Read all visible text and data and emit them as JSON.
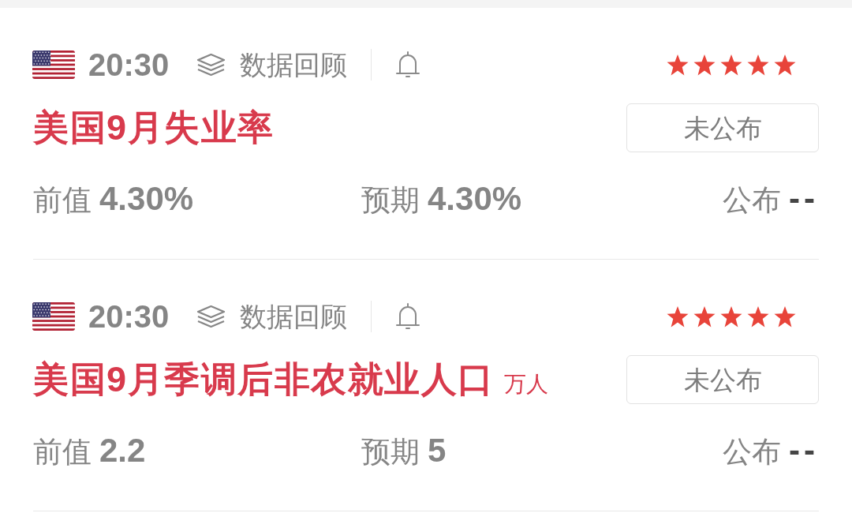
{
  "events": [
    {
      "time": "20:30",
      "review_link": "数据回顾",
      "stars": 5,
      "title": "美国9月失业率",
      "status": "未公布",
      "previous": {
        "label": "前值",
        "value": "4.30%"
      },
      "forecast": {
        "label": "预期",
        "value": "4.30%"
      },
      "actual": {
        "label": "公布",
        "value": "--"
      }
    },
    {
      "time": "20:30",
      "review_link": "数据回顾",
      "stars": 5,
      "title": "美国9月季调后非农就业人口",
      "unit": "万人",
      "status": "未公布",
      "previous": {
        "label": "前值",
        "value": "2.2"
      },
      "forecast": {
        "label": "预期",
        "value": "5"
      },
      "actual": {
        "label": "公布",
        "value": "--"
      }
    }
  ]
}
